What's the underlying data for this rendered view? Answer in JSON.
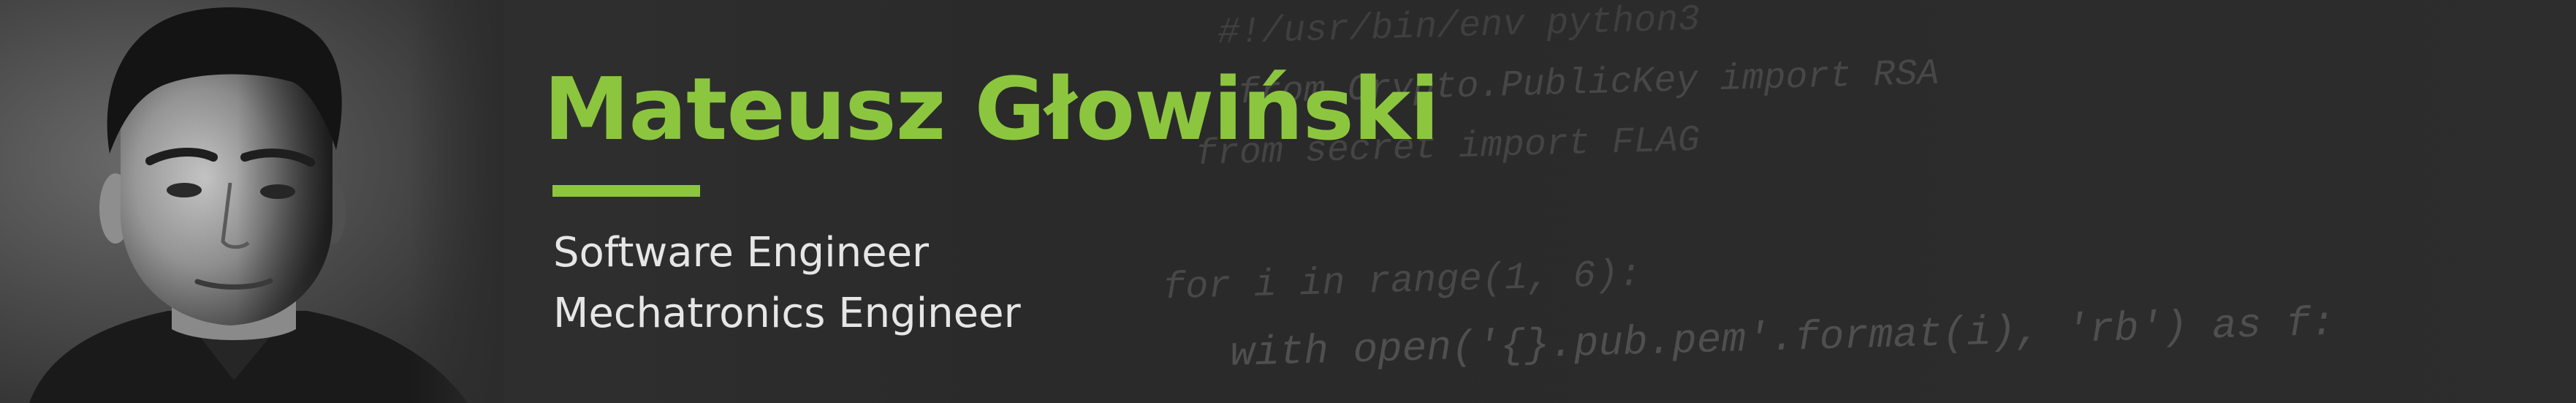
{
  "profile": {
    "name": "Mateusz Głowiński",
    "roles": [
      "Software Engineer",
      "Mechatronics Engineer"
    ]
  },
  "background_code": [
    "#!/usr/bin/env python3",
    "from Crypto.PublicKey import RSA",
    "from secret import FLAG",
    "for i in range(1, 6):",
    "with open('{}.pub.pem'.format(i), 'rb') as f:"
  ],
  "colors": {
    "accent": "#8cc63f",
    "background": "#2c2c2c",
    "role_text": "#e6e6e6",
    "code_text": "#4a4a4a"
  }
}
